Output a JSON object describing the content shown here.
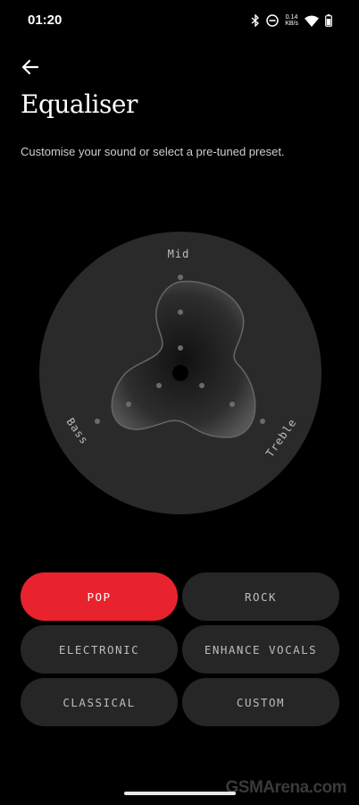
{
  "status": {
    "time": "01:20",
    "net_value": "0.14",
    "net_unit": "KB/s"
  },
  "page": {
    "title": "Equaliser",
    "subtitle": "Customise your sound or select a pre-tuned preset."
  },
  "equaliser": {
    "labels": {
      "mid": "Mid",
      "bass": "Bass",
      "treble": "Treble"
    }
  },
  "presets": [
    {
      "label": "POP",
      "active": true
    },
    {
      "label": "ROCK",
      "active": false
    },
    {
      "label": "ELECTRONIC",
      "active": false
    },
    {
      "label": "ENHANCE VOCALS",
      "active": false
    },
    {
      "label": "CLASSICAL",
      "active": false
    },
    {
      "label": "CUSTOM",
      "active": false
    }
  ],
  "colors": {
    "accent": "#e8232e",
    "button_bg": "#262626",
    "dial_bg": "#2a2a2a"
  },
  "watermark": "GSMArena.com"
}
